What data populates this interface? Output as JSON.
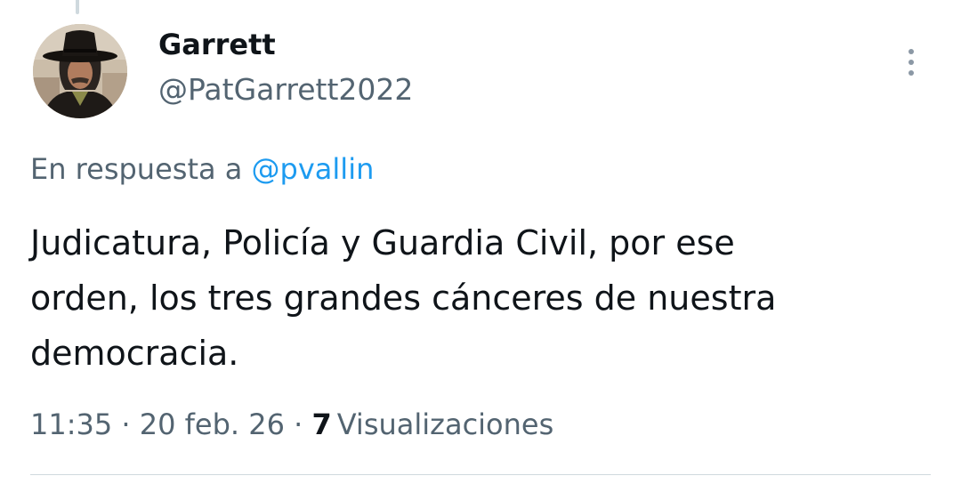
{
  "author": {
    "display_name": "Garrett",
    "handle": "@PatGarrett2022"
  },
  "reply": {
    "prefix": "En respuesta a",
    "mention": "@pvallin"
  },
  "tweet": {
    "text": "Judicatura, Policía y Guardia Civil, por ese\norden, los tres grandes cánceres de nuestra\ndemocracia."
  },
  "meta": {
    "time": "11:35",
    "separator": "·",
    "date": "20 feb. 26",
    "views_count": "7",
    "views_label": "Visualizaciones"
  },
  "icons": {
    "more": "more-vertical-icon",
    "avatar": "avatar-image"
  },
  "colors": {
    "text_primary": "#0f1419",
    "text_secondary": "#536471",
    "link": "#1d9bf0",
    "divider": "#cfd9de"
  }
}
